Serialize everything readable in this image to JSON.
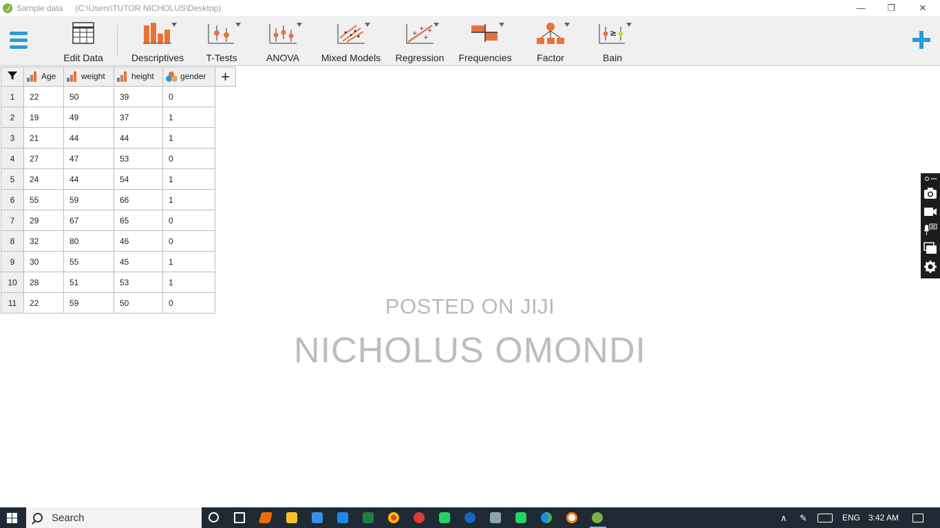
{
  "window": {
    "title": "Sample data",
    "path": "(C:\\Users\\TUTOR NICHOLUS\\Desktop)",
    "minimize": "—",
    "restore": "❐",
    "close": "✕"
  },
  "ribbon": {
    "items": [
      {
        "label": "Edit Data"
      },
      {
        "label": "Descriptives"
      },
      {
        "label": "T-Tests"
      },
      {
        "label": "ANOVA"
      },
      {
        "label": "Mixed Models"
      },
      {
        "label": "Regression"
      },
      {
        "label": "Frequencies"
      },
      {
        "label": "Factor"
      },
      {
        "label": "Bain"
      }
    ]
  },
  "grid": {
    "columns": [
      "Age",
      "weight",
      "height",
      "gender"
    ],
    "rows": [
      {
        "n": "1",
        "cells": [
          "22",
          "50",
          "39",
          "0"
        ]
      },
      {
        "n": "2",
        "cells": [
          "19",
          "49",
          "37",
          "1"
        ]
      },
      {
        "n": "3",
        "cells": [
          "21",
          "44",
          "44",
          "1"
        ]
      },
      {
        "n": "4",
        "cells": [
          "27",
          "47",
          "53",
          "0"
        ]
      },
      {
        "n": "5",
        "cells": [
          "24",
          "44",
          "54",
          "1"
        ]
      },
      {
        "n": "6",
        "cells": [
          "55",
          "59",
          "66",
          "1"
        ]
      },
      {
        "n": "7",
        "cells": [
          "29",
          "67",
          "65",
          "0"
        ]
      },
      {
        "n": "8",
        "cells": [
          "32",
          "80",
          "46",
          "0"
        ]
      },
      {
        "n": "9",
        "cells": [
          "30",
          "55",
          "45",
          "1"
        ]
      },
      {
        "n": "10",
        "cells": [
          "28",
          "51",
          "53",
          "1"
        ]
      },
      {
        "n": "11",
        "cells": [
          "22",
          "59",
          "50",
          "0"
        ]
      }
    ]
  },
  "watermark": {
    "line1": "POSTED ON JIJI",
    "line2": "NICHOLUS OMONDI"
  },
  "taskbar": {
    "search_label": "Search",
    "language": "ENG",
    "time": "3:42 AM"
  },
  "colors": {
    "accent": "#2a9ad8",
    "ribbon_orange": "#e8733a",
    "taskbar": "#1f2a35"
  }
}
